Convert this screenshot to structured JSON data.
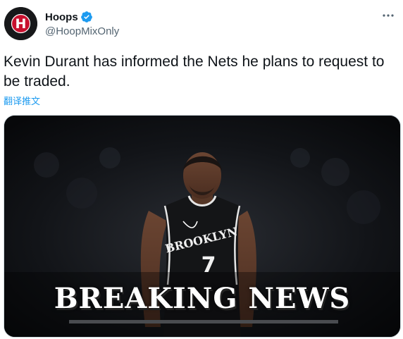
{
  "tweet": {
    "author": {
      "display_name": "Hoops",
      "handle": "@HoopMixOnly",
      "avatar_letter": "H",
      "verified": true
    },
    "text": "Kevin Durant has informed the Nets he plans to request to be traded.",
    "translate_label": "翻译推文",
    "media": {
      "overlay_text": "BREAKING NEWS",
      "jersey_text": "BROOKLYN",
      "jersey_number": "7"
    }
  },
  "colors": {
    "accent": "#1d9bf0",
    "text_primary": "#0f1419",
    "text_secondary": "#536471",
    "avatar_red": "#c8102e"
  }
}
